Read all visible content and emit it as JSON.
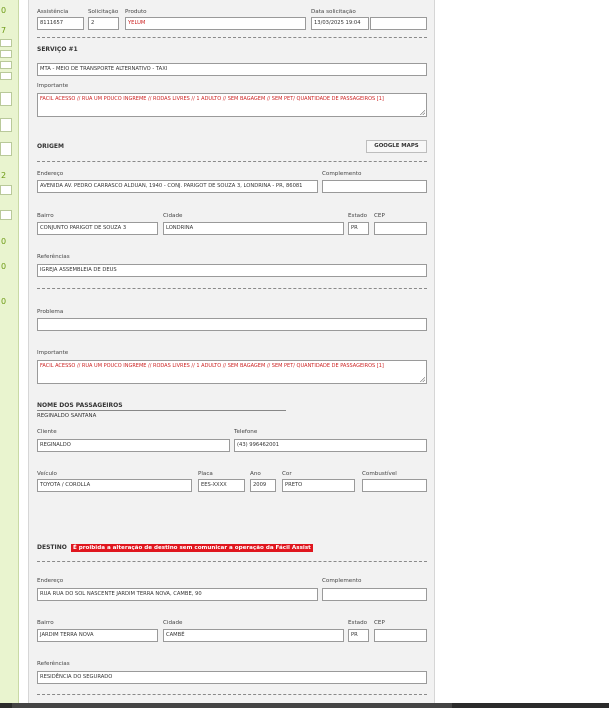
{
  "left_strip": {
    "numbers": [
      "0",
      "7",
      "2",
      "0",
      "0",
      "0"
    ]
  },
  "header": {
    "assistencia_label": "Assistência",
    "assistencia_value": "8111657",
    "solicitacao_label": "Solicitação",
    "solicitacao_value": "2",
    "produto_label": "Produto",
    "produto_value": "YELUM",
    "data_label": "Data solicitação",
    "data_value": "13/03/2025 19:04",
    "data_extra_value": ""
  },
  "servico": {
    "title": "SERVIÇO #1",
    "tipo_value": "MTA - MEIO DE TRANSPORTE ALTERNATIVO - TAXI",
    "importante_label": "Importante",
    "importante_value": "FACIL ACESSO // RUA UM POUCO INGREME // RODAS LIVRES // 1 ADULTO // SEM BAGAGEM // SEM PET/ QUANTIDADE DE PASSAGEIROS [1]"
  },
  "origem": {
    "title": "ORIGEM",
    "maps_button": "GOOGLE MAPS",
    "endereco_label": "Endereço",
    "endereco_value": "AVENIDA AV. PEDRO CARRASCO ALDUAN, 1940 - CONJ. PARIGOT DE SOUZA 3, LONDRINA - PR, 86081",
    "complemento_label": "Complemento",
    "complemento_value": "",
    "bairro_label": "Bairro",
    "bairro_value": "CONJUNTO PARIGOT DE SOUZA 3",
    "cidade_label": "Cidade",
    "cidade_value": "LONDRINA",
    "estado_label": "Estado",
    "estado_value": "PR",
    "cep_label": "CEP",
    "cep_value": "",
    "referencias_label": "Referências",
    "referencias_value": "IGREJA ASSEMBLEIA DE DEUS"
  },
  "problema": {
    "label": "Problema",
    "value": "",
    "importante_label": "Importante",
    "importante_value": "FACIL ACESSO // RUA UM POUCO INGREME // RODAS LIVRES // 1 ADULTO // SEM BAGAGEM // SEM PET/ QUANTIDADE DE PASSAGEIROS [1]"
  },
  "passageiros": {
    "title": "NOME DOS PASSAGEIROS",
    "name": "REGINALDO SANTANA",
    "cliente_label": "Cliente",
    "cliente_value": "REGINALDO",
    "telefone_label": "Telefone",
    "telefone_value": "(43) 996462001"
  },
  "veiculo": {
    "veiculo_label": "Veículo",
    "veiculo_value": "TOYOTA / COROLLA",
    "placa_label": "Placa",
    "placa_value": "EES-XXXX",
    "ano_label": "Ano",
    "ano_value": "2009",
    "cor_label": "Cor",
    "cor_value": "PRETO",
    "combustivel_label": "Combustível",
    "combustivel_value": ""
  },
  "destino": {
    "title": "DESTINO",
    "warning": "É proibida a alteração de destino sem comunicar a operação da Fácil Assist",
    "endereco_label": "Endereço",
    "endereco_value": "RUA RUA DO SOL NASCENTE JARDIM TERRA NOVA, CAMBE, 90",
    "complemento_label": "Complemento",
    "complemento_value": "",
    "bairro_label": "Bairro",
    "bairro_value": "JARDIM TERRA NOVA",
    "cidade_label": "Cidade",
    "cidade_value": "CAMBÉ",
    "estado_label": "Estado",
    "estado_value": "PR",
    "cep_label": "CEP",
    "cep_value": "",
    "referencias_label": "Referências",
    "referencias_value": "RESIDÊNCIA DO SEGURADO"
  },
  "colors": {
    "accent_red": "#cc2222",
    "warning_bg": "#e0161e",
    "strip_green": "#6c9a13"
  }
}
